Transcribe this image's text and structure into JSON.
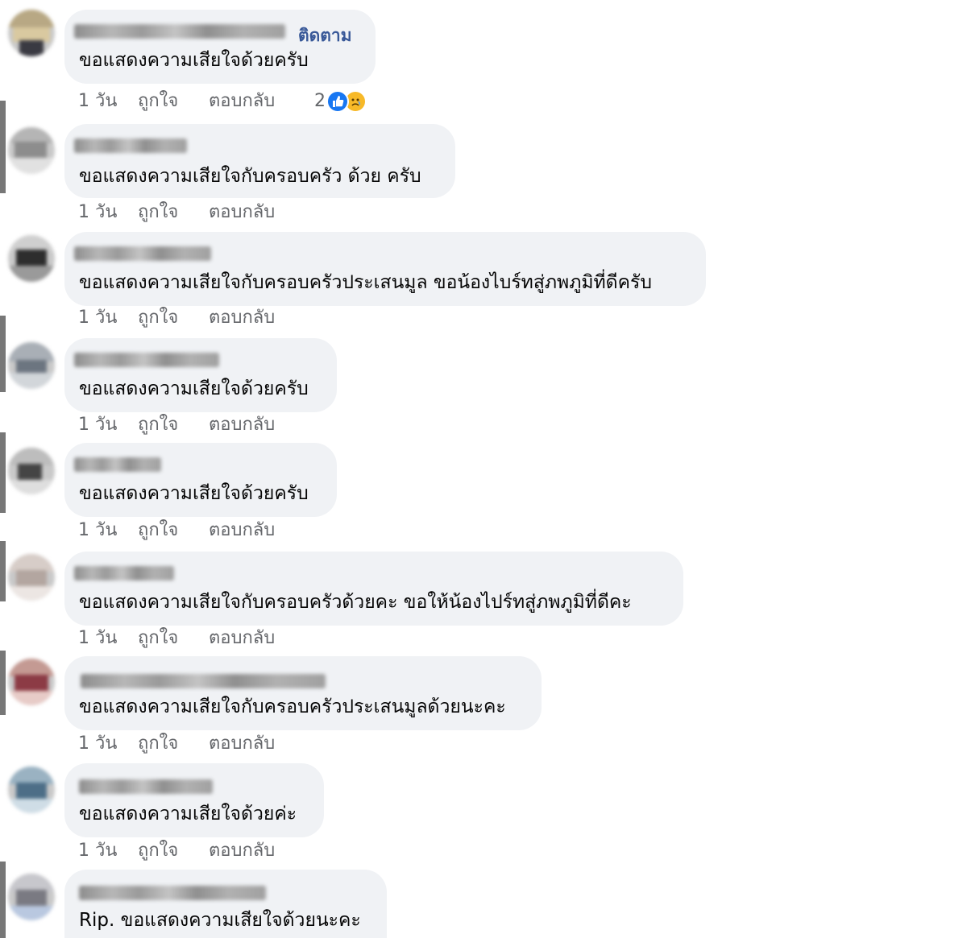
{
  "comments": [
    {
      "follow_label": "ติดตาม",
      "text": "ขอแสดงความเสียใจด้วยครับ",
      "time": "1 วัน",
      "like": "ถูกใจ",
      "reply": "ตอบกลับ",
      "reaction_count": "2",
      "reactions": [
        "like-icon",
        "sad-icon"
      ]
    },
    {
      "text": "ขอแสดงความเสียใจกับครอบครัว ด้วย ครับ",
      "time": "1 วัน",
      "like": "ถูกใจ",
      "reply": "ตอบกลับ"
    },
    {
      "text": "ขอแสดงความเสียใจกับครอบครัวประเสนมูล ขอน้องไบร์ทสู่ภพภูมิที่ดีครับ",
      "time": "1 วัน",
      "like": "ถูกใจ",
      "reply": "ตอบกลับ"
    },
    {
      "text": "ขอแสดงความเสียใจด้วยครับ",
      "time": "1 วัน",
      "like": "ถูกใจ",
      "reply": "ตอบกลับ"
    },
    {
      "text": "ขอแสดงความเสียใจด้วยครับ",
      "time": "1 วัน",
      "like": "ถูกใจ",
      "reply": "ตอบกลับ"
    },
    {
      "text": "ขอแสดงความเสียใจกับครอบครัวด้วยคะ ขอให้น้องไปร์ทสู่ภพภูมิที่ดีคะ",
      "time": "1 วัน",
      "like": "ถูกใจ",
      "reply": "ตอบกลับ"
    },
    {
      "text": "ขอแสดงความเสียใจกับครอบครัวประเสนมูลด้วยนะคะ",
      "time": "1 วัน",
      "like": "ถูกใจ",
      "reply": "ตอบกลับ"
    },
    {
      "text": "ขอแสดงความเสียใจด้วยค่ะ",
      "time": "1 วัน",
      "like": "ถูกใจ",
      "reply": "ตอบกลับ"
    },
    {
      "text": "Rip. ขอแสดงความเสียใจด้วยนะคะ"
    }
  ],
  "colors": {
    "bubble_bg": "#f0f2f5",
    "follow_link": "#385898",
    "meta_text": "#65676b",
    "like_reaction": "#1877f2",
    "sad_reaction": "#f7b928"
  }
}
